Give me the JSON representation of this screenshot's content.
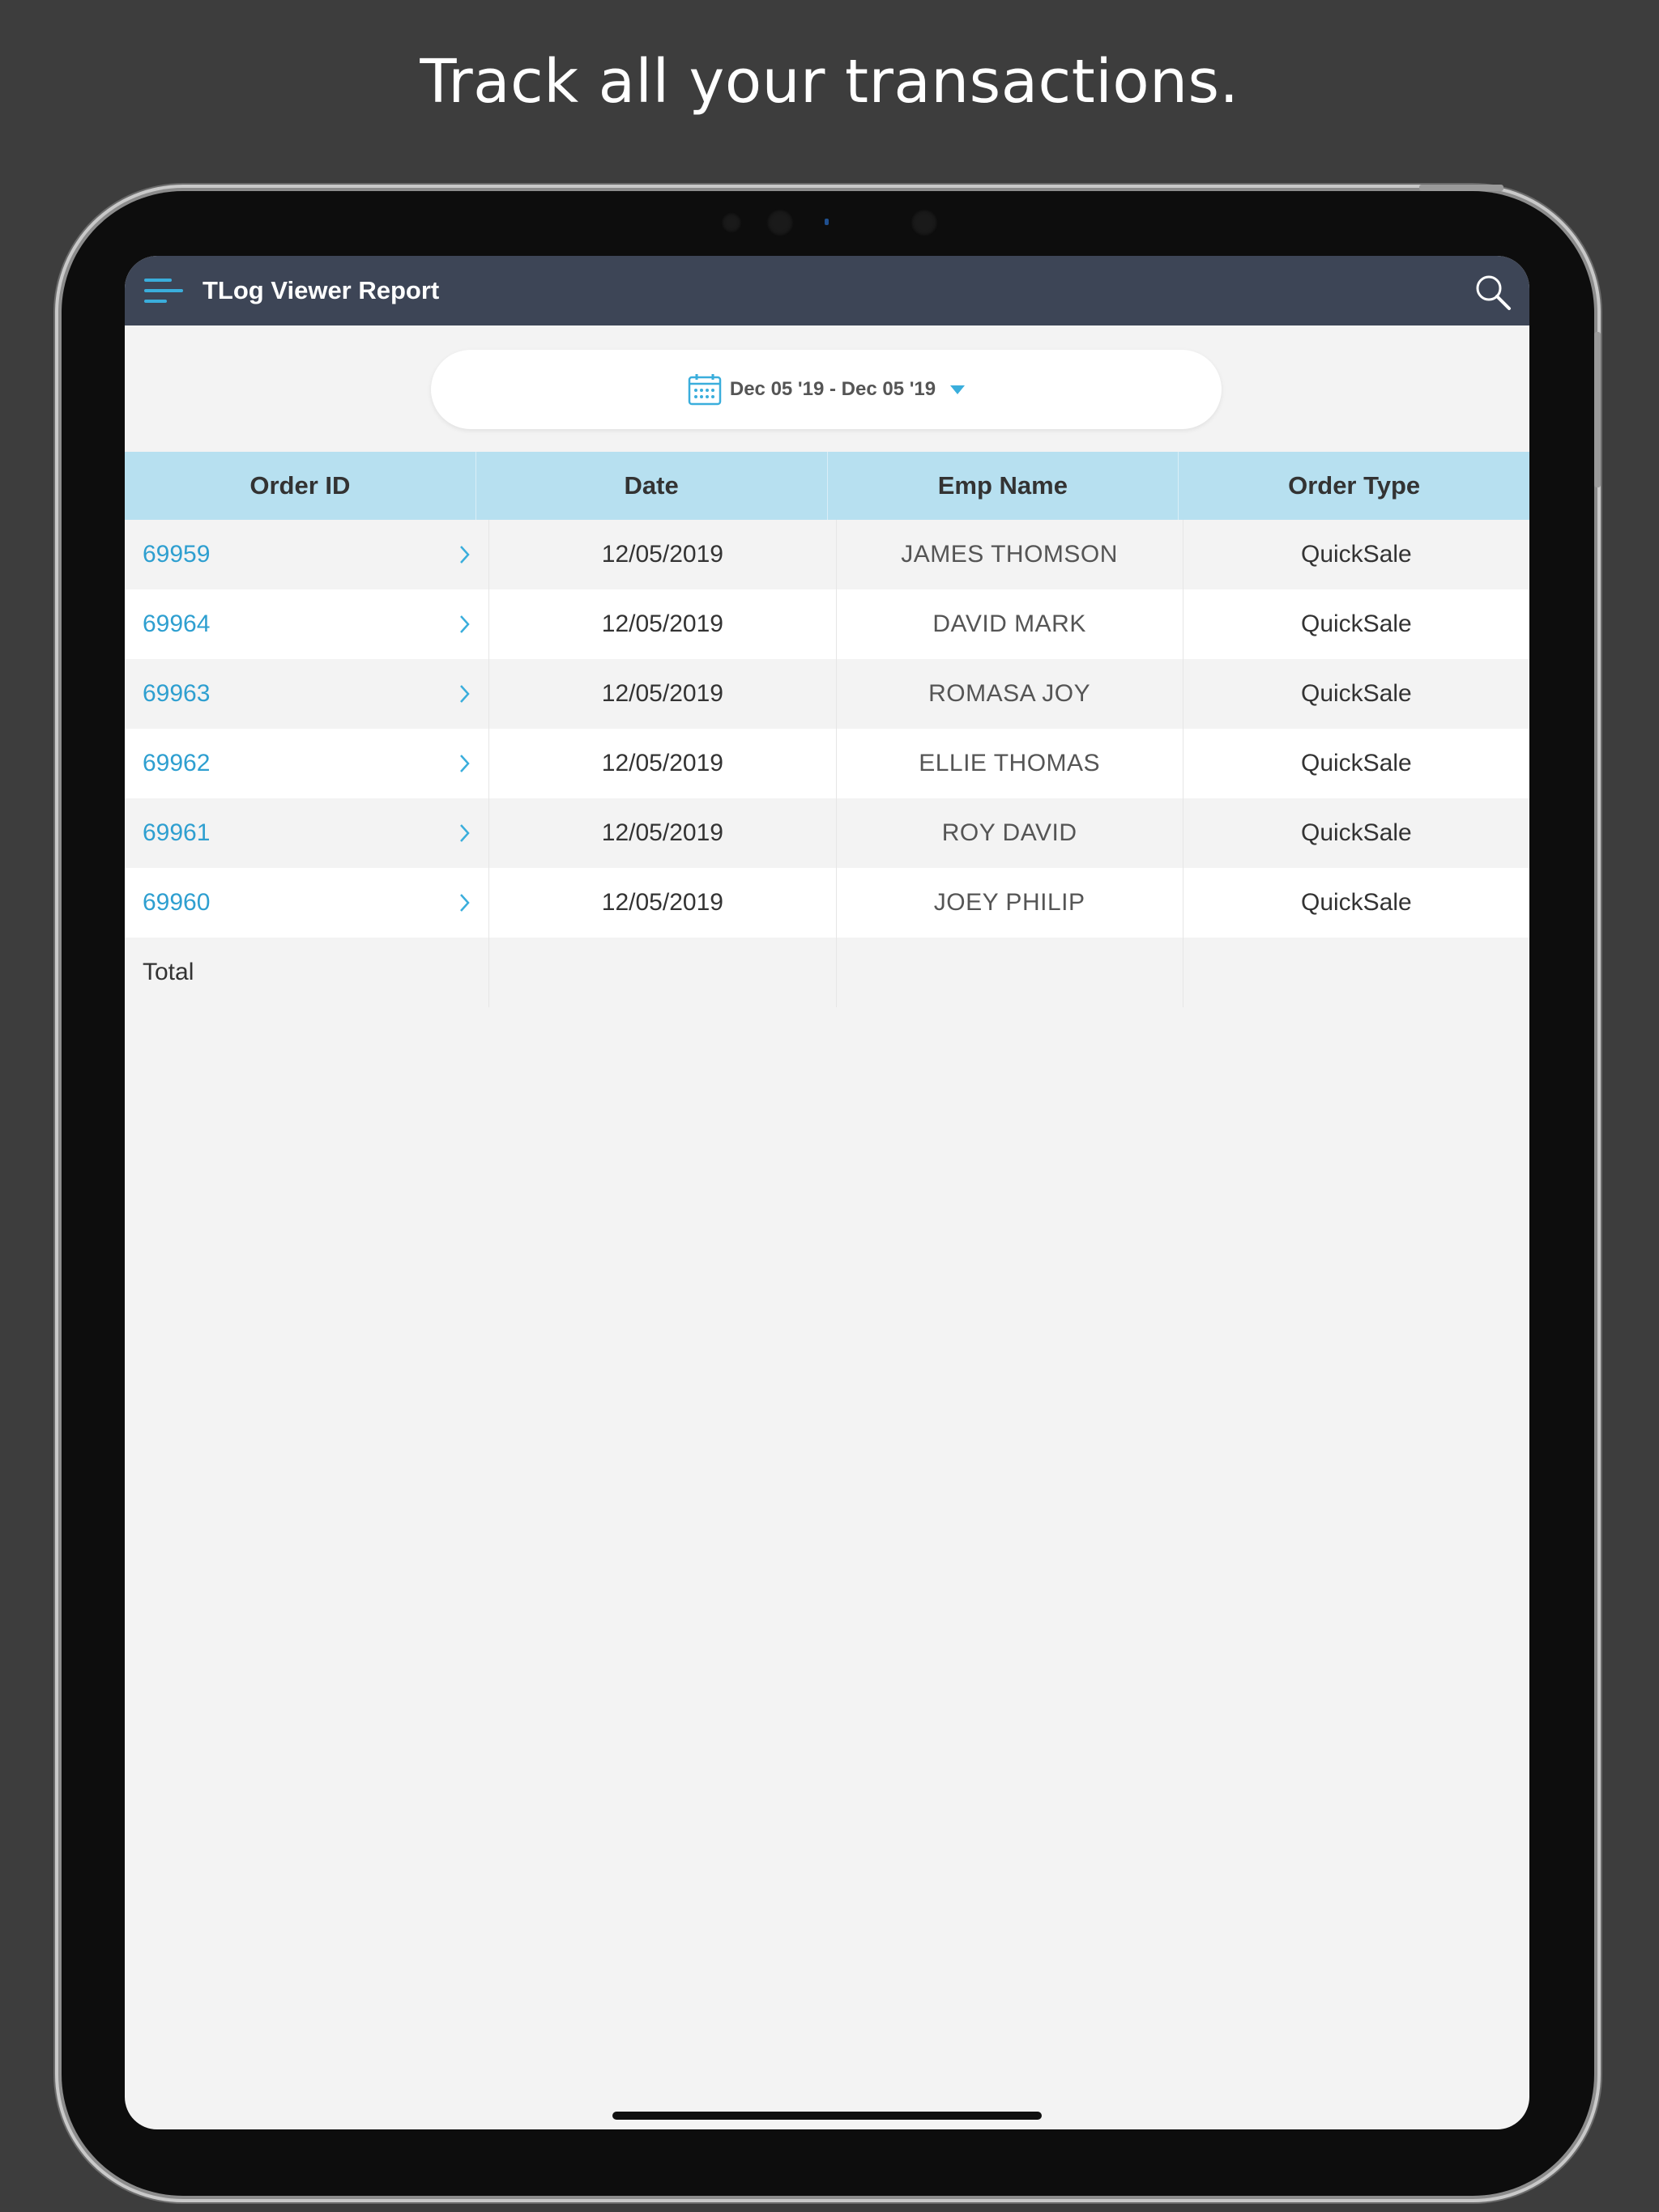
{
  "promo": {
    "headline": "Track all your transactions."
  },
  "navbar": {
    "title": "TLog Viewer Report",
    "menu_icon": "hamburger-menu-icon",
    "search_icon": "search-icon",
    "bg_color": "#3d4556"
  },
  "date_filter": {
    "icon": "calendar-icon",
    "range": "Dec 05 '19 - Dec 05 '19"
  },
  "table": {
    "headers": [
      "Order ID",
      "Date",
      "Emp Name",
      "Order Type"
    ],
    "header_color": "#b7e0f0",
    "link_color": "#2e9fd0",
    "rows": [
      {
        "order_id": "69959",
        "date": "12/05/2019",
        "emp_name": "JAMES THOMSON",
        "order_type": "QuickSale"
      },
      {
        "order_id": "69964",
        "date": "12/05/2019",
        "emp_name": "DAVID MARK",
        "order_type": "QuickSale"
      },
      {
        "order_id": "69963",
        "date": "12/05/2019",
        "emp_name": "ROMASA JOY",
        "order_type": "QuickSale"
      },
      {
        "order_id": "69962",
        "date": "12/05/2019",
        "emp_name": "ELLIE THOMAS",
        "order_type": "QuickSale"
      },
      {
        "order_id": "69961",
        "date": "12/05/2019",
        "emp_name": "ROY DAVID",
        "order_type": "QuickSale"
      },
      {
        "order_id": "69960",
        "date": "12/05/2019",
        "emp_name": "JOEY PHILIP",
        "order_type": "QuickSale"
      }
    ],
    "total_label": "Total"
  }
}
